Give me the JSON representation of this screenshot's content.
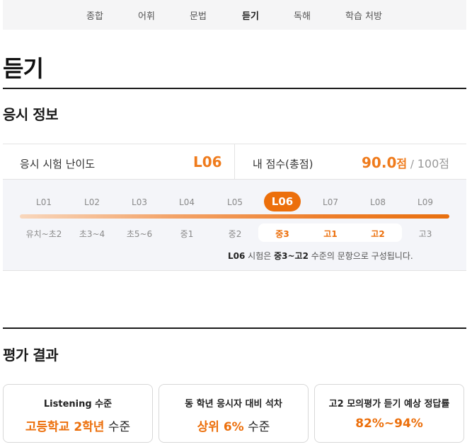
{
  "tabs": [
    {
      "label": "종합"
    },
    {
      "label": "어휘"
    },
    {
      "label": "문법"
    },
    {
      "label": "듣기",
      "active": true
    },
    {
      "label": "독해"
    },
    {
      "label": "학습 처방"
    }
  ],
  "page_title": "듣기",
  "exam_info": {
    "section_title": "응시 정보",
    "difficulty_label": "응시 시험 난이도",
    "difficulty_value": "L06",
    "score_label": "내 점수(총점)",
    "score_value": "90.0",
    "score_unit": "점",
    "score_separator": "/",
    "score_total": "100점"
  },
  "levels": {
    "items": [
      "L01",
      "L02",
      "L03",
      "L04",
      "L05",
      "L06",
      "L07",
      "L08",
      "L09"
    ],
    "current": "L06",
    "grades": [
      "유치~초2",
      "초3~4",
      "초5~6",
      "중1",
      "중2",
      "중3",
      "고1",
      "고2",
      "고3"
    ],
    "highlight_grades": [
      "중3",
      "고1",
      "고2"
    ],
    "note_level": "L06",
    "note_mid1": " 시험은 ",
    "note_range": "중3~고2",
    "note_end": " 수준의 문항으로 구성됩니다."
  },
  "results": {
    "section_title": "평가 결과",
    "cards": [
      {
        "title": "Listening 수준",
        "highlight": "고등학교 2학년",
        "suffix": " 수준"
      },
      {
        "title": "동 학년 응시자 대비 석차",
        "highlight": "상위 6%",
        "suffix": " 수준"
      },
      {
        "title": "고2 모의평가 듣기 예상 정답률",
        "highlight": "82%~94%",
        "suffix": ""
      }
    ]
  },
  "colors": {
    "accent": "#ec6f0b",
    "panel_bg": "#f4f5f9",
    "tabbar_bg": "#f5f5f6"
  }
}
